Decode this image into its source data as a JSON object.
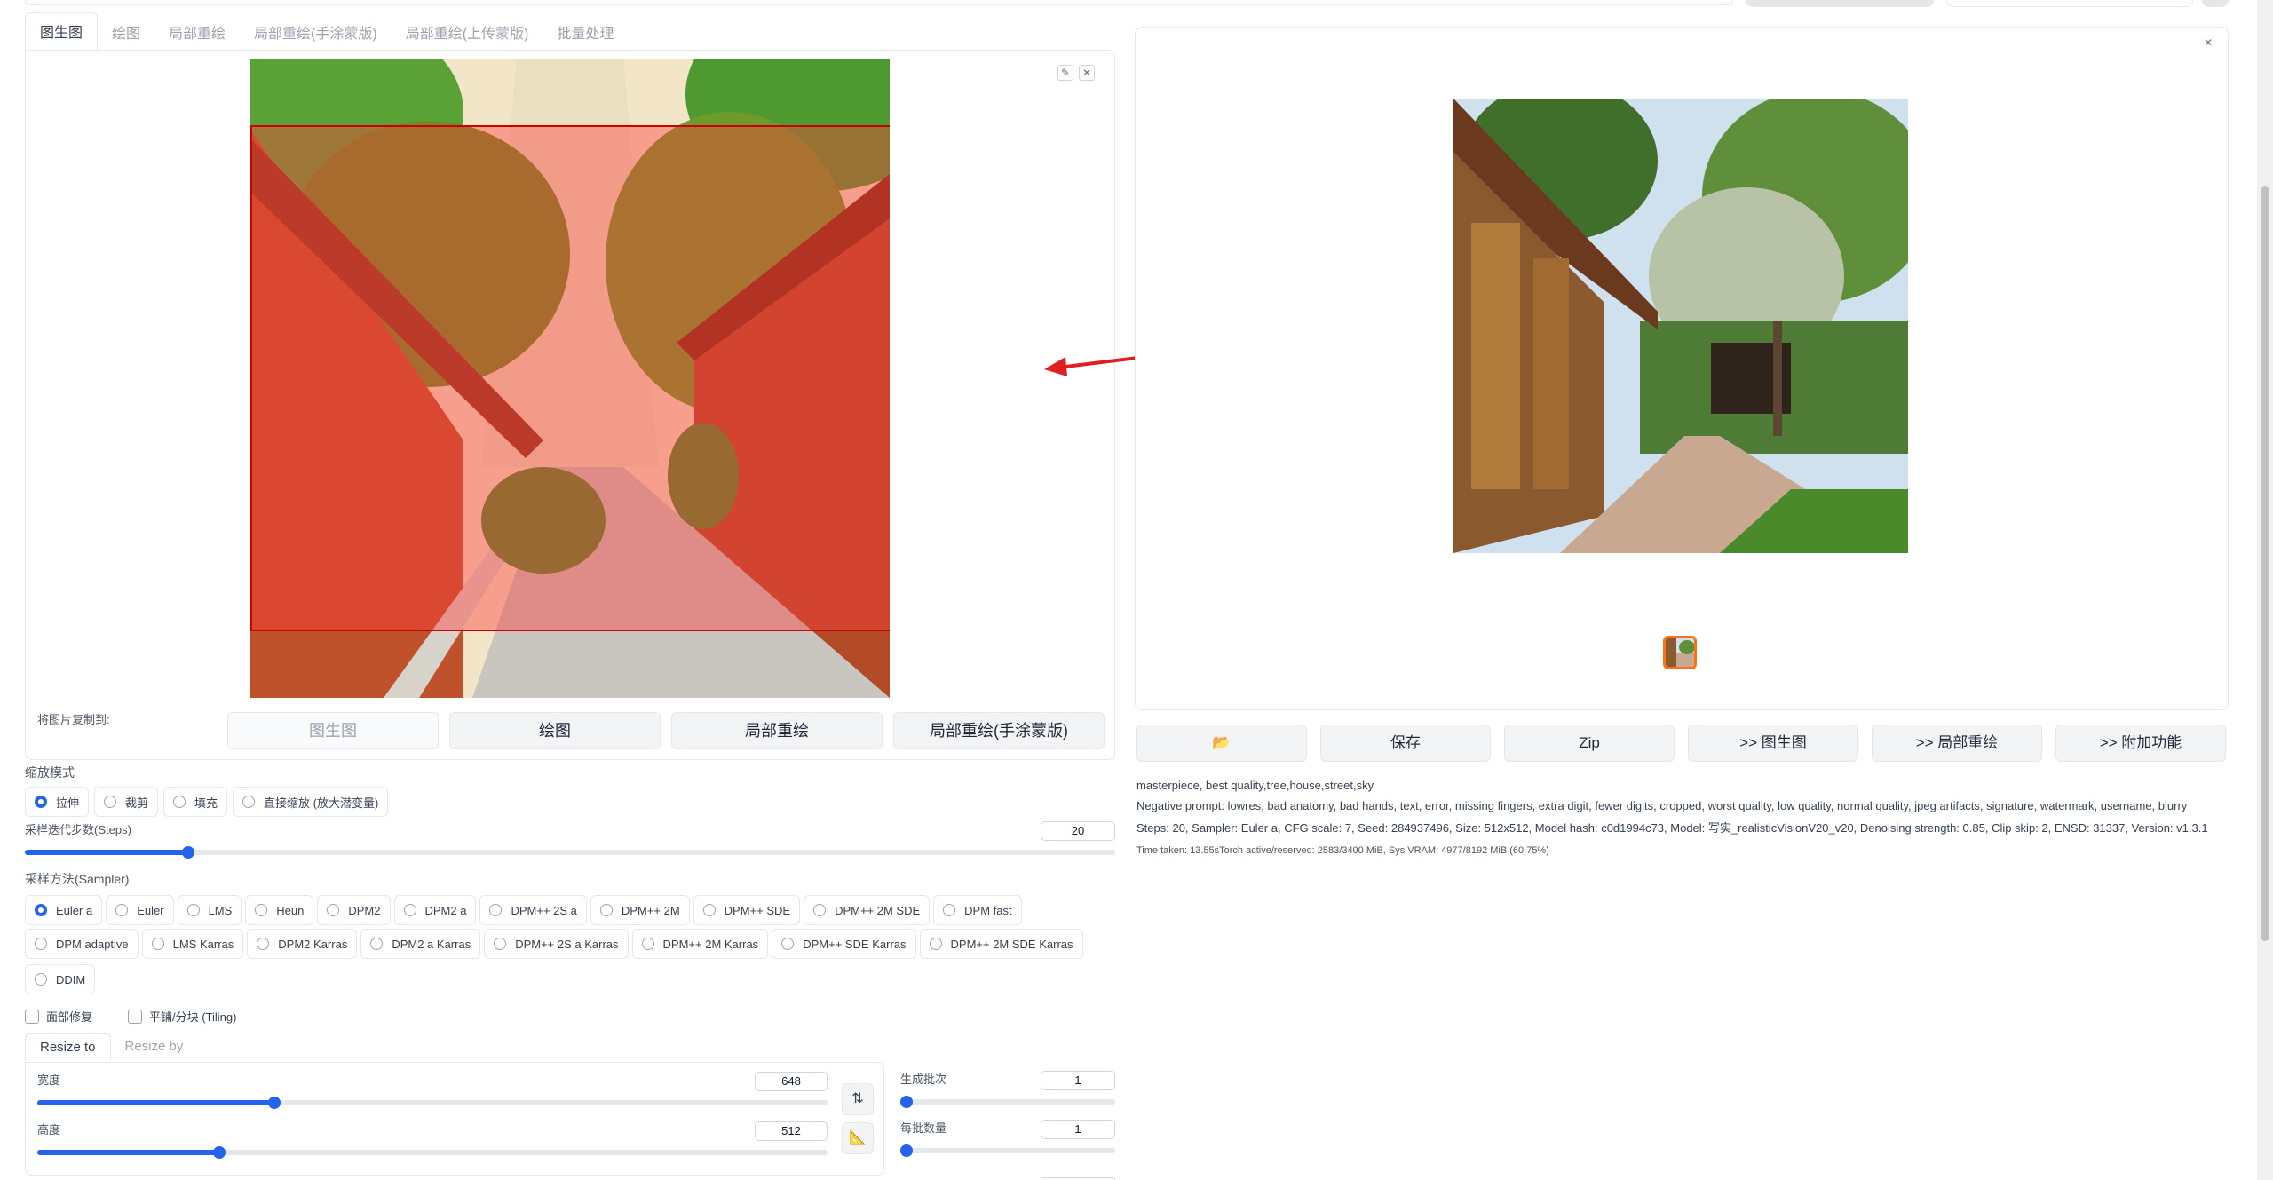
{
  "tabs": [
    "图生图",
    "绘图",
    "局部重绘",
    "局部重绘(手涂蒙版)",
    "局部重绘(上传蒙版)",
    "批量处理"
  ],
  "copy_to": {
    "label": "将图片复制到:",
    "buttons": [
      "图生图",
      "绘图",
      "局部重绘",
      "局部重绘(手涂蒙版)"
    ]
  },
  "resize_mode": {
    "label": "缩放模式",
    "options": [
      "拉伸",
      "裁剪",
      "填充",
      "直接缩放 (放大潜变量)"
    ],
    "selected": 0
  },
  "steps": {
    "label": "采样迭代步数(Steps)",
    "value": "20",
    "fraction": 0.15
  },
  "sampler": {
    "label": "采样方法(Sampler)",
    "selected": 0,
    "row1": [
      "Euler a",
      "Euler",
      "LMS",
      "Heun",
      "DPM2",
      "DPM2 a",
      "DPM++ 2S a",
      "DPM++ 2M",
      "DPM++ SDE",
      "DPM++ 2M SDE",
      "DPM fast"
    ],
    "row2": [
      "DPM adaptive",
      "LMS Karras",
      "DPM2 Karras",
      "DPM2 a Karras",
      "DPM++ 2S a Karras",
      "DPM++ 2M Karras",
      "DPM++ SDE Karras",
      "DPM++ 2M SDE Karras"
    ],
    "row3": [
      "DDIM"
    ]
  },
  "checks": {
    "face": "面部修复",
    "tiling": "平铺/分块 (Tiling)"
  },
  "resize_tabs": [
    "Resize to",
    "Resize by"
  ],
  "width": {
    "label": "宽度",
    "value": "648",
    "fraction": 0.3
  },
  "height": {
    "label": "高度",
    "value": "512",
    "fraction": 0.23
  },
  "batch_count": {
    "label": "生成批次",
    "value": "1",
    "fraction": 0.0
  },
  "batch_size": {
    "label": "每批数量",
    "value": "1",
    "fraction": 0.0
  },
  "swap_icon": "⇅",
  "ruler_icon": "📐",
  "actions": [
    "📂",
    "保存",
    "Zip",
    ">> 图生图",
    ">> 局部重绘",
    ">> 附加功能"
  ],
  "info": {
    "prompt": "masterpiece, best quality,tree,house,street,sky",
    "negative": "Negative prompt: lowres, bad anatomy, bad hands, text, error, missing fingers, extra digit, fewer digits, cropped, worst quality, low quality, normal quality, jpeg artifacts, signature, watermark, username, blurry",
    "params": "Steps: 20, Sampler: Euler a, CFG scale: 7, Seed: 284937496, Size: 512x512, Model hash: c0d1994c73, Model: 写实_realisticVisionV20_v20, Denoising strength: 0.85, Clip skip: 2, ENSD: 31337, Version: v1.3.1",
    "time": "Time taken: 13.55sTorch active/reserved: 2583/3400 MiB, Sys VRAM: 4977/8192 MiB (60.75%)"
  },
  "colors": {
    "accent": "#2563eb",
    "mask": "#cc0000",
    "arrow": "#e02020",
    "thumb_border": "#f97316"
  }
}
